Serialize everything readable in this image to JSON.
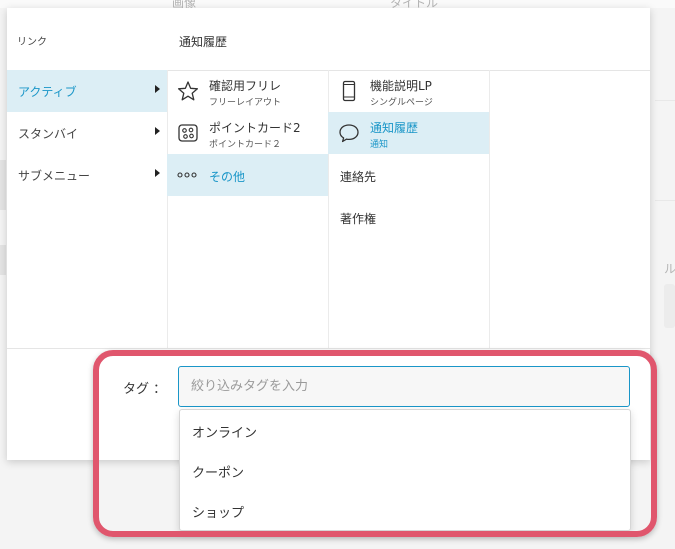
{
  "background": {
    "headers": [
      "画像",
      "タイトル"
    ]
  },
  "panel": {
    "link_label": "リンク",
    "selected_title": "通知履歴"
  },
  "menu": {
    "items": [
      {
        "label": "アクティブ",
        "active": true
      },
      {
        "label": "スタンバイ",
        "active": false
      },
      {
        "label": "サブメニュー",
        "active": false
      }
    ]
  },
  "pages": {
    "items": [
      {
        "title": "確認用フリレ",
        "subtitle": "フリーレイアウト",
        "icon": "star-icon"
      },
      {
        "title": "ポイントカード2",
        "subtitle": "ポイントカード２",
        "icon": "point-card-icon"
      },
      {
        "title": "その他",
        "icon": "more-icon",
        "active": true
      }
    ]
  },
  "subpages": {
    "items": [
      {
        "title": "機能説明LP",
        "subtitle": "シングルページ",
        "icon": "smartphone-icon"
      },
      {
        "title": "通知履歴",
        "subtitle": "通知",
        "icon": "speech-bubble-icon",
        "active": true
      },
      {
        "title": "連絡先"
      },
      {
        "title": "著作権"
      }
    ]
  },
  "tag": {
    "label": "タグ ：",
    "placeholder": "絞り込みタグを入力",
    "value": "",
    "options": [
      "オンライン",
      "クーポン",
      "ショップ"
    ]
  },
  "colors": {
    "accent": "#1a96c8",
    "active_bg": "#dceef5",
    "highlight": "#e0566d"
  }
}
